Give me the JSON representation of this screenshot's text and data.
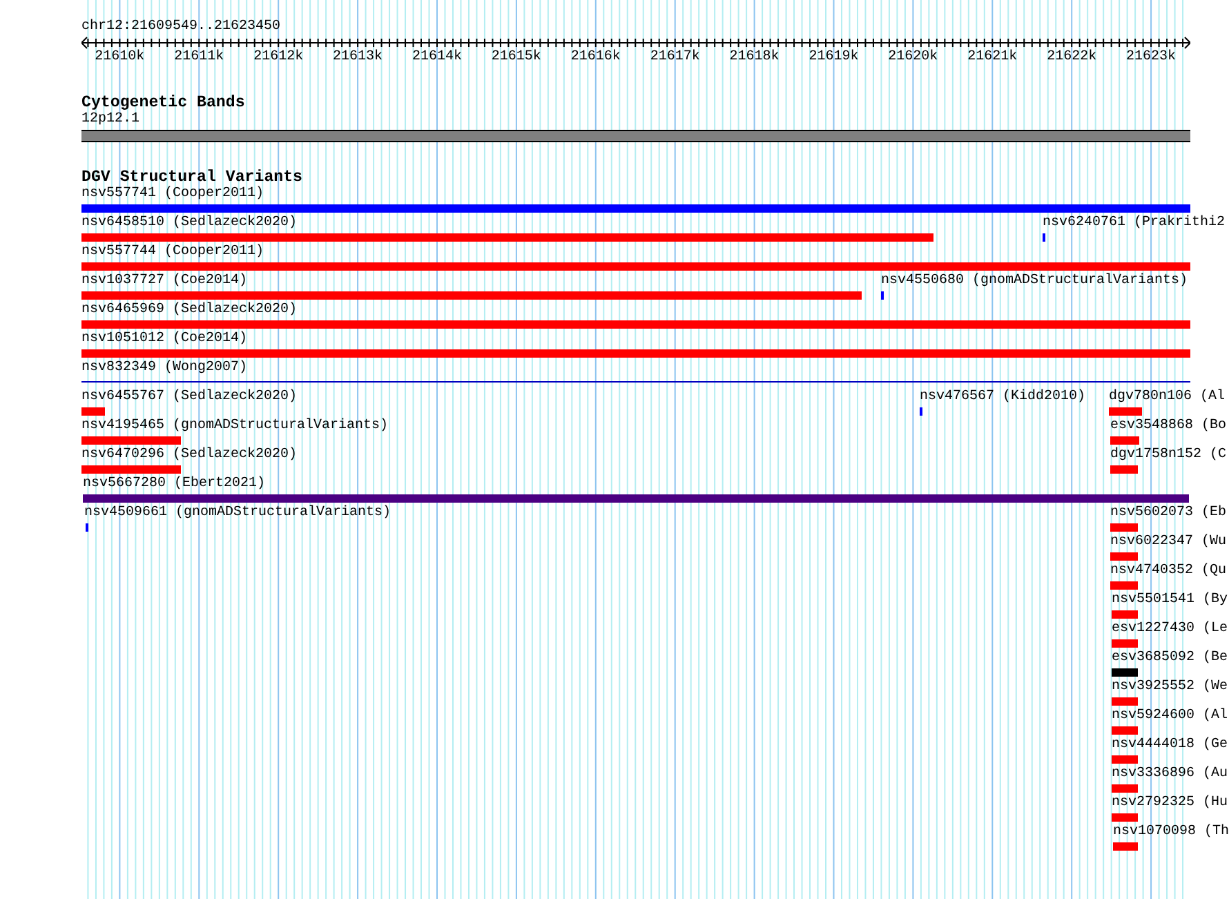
{
  "ruler": {
    "location": "chr12:21609549..21623450",
    "ticks": [
      "21610k",
      "21611k",
      "21612k",
      "21613k",
      "21614k",
      "21615k",
      "21616k",
      "21617k",
      "21618k",
      "21619k",
      "21620k",
      "21621k",
      "21622k",
      "21623k"
    ]
  },
  "tracks": [
    {
      "kind": "bands",
      "title": "Cytogenetic Bands",
      "features": [
        {
          "label": "12p12.1",
          "color": "#808080"
        }
      ]
    },
    {
      "kind": "variants",
      "title": "DGV Structural Variants",
      "features": [
        {
          "label": "nsv557741 (Cooper2011)",
          "color": "#0000ff"
        },
        {
          "label": "nsv6458510 (Sedlazeck2020)",
          "color": "#ff0000"
        },
        {
          "label": "nsv6240761 (Prakrithi2",
          "color": "#0000ff"
        },
        {
          "label": "nsv557744 (Cooper2011)",
          "color": "#ff0000"
        },
        {
          "label": "nsv1037727 (Coe2014)",
          "color": "#ff0000"
        },
        {
          "label": "nsv4550680 (gnomADStructuralVariants)",
          "color": "#0000ff"
        },
        {
          "label": "nsv6465969 (Sedlazeck2020)",
          "color": "#ff0000"
        },
        {
          "label": "nsv1051012 (Coe2014)",
          "color": "#ff0000"
        },
        {
          "label": "nsv832349 (Wong2007)",
          "color": "#0000c0"
        },
        {
          "label": "nsv6455767 (Sedlazeck2020)",
          "color": "#ff0000"
        },
        {
          "label": "nsv476567 (Kidd2010)",
          "color": "#0000ff"
        },
        {
          "label": "dgv780n106 (Al",
          "color": "#ff0000"
        },
        {
          "label": "nsv4195465 (gnomADStructuralVariants)",
          "color": "#ff0000"
        },
        {
          "label": "esv3548868 (Bo",
          "color": "#ff0000"
        },
        {
          "label": "nsv6470296 (Sedlazeck2020)",
          "color": "#ff0000"
        },
        {
          "label": "dgv1758n152 (C",
          "color": "#ff0000"
        },
        {
          "label": "nsv5667280 (Ebert2021)",
          "color": "#4b0082"
        },
        {
          "label": "nsv4509661 (gnomADStructuralVariants)",
          "color": "#0000ff"
        },
        {
          "label": "nsv5602073 (Eb",
          "color": "#ff0000"
        },
        {
          "label": "nsv6022347 (Wu",
          "color": "#ff0000"
        },
        {
          "label": "nsv4740352 (Qu",
          "color": "#ff0000"
        },
        {
          "label": "nsv5501541 (By",
          "color": "#ff0000"
        },
        {
          "label": "esv1227430 (Le",
          "color": "#ff0000"
        },
        {
          "label": "esv3685092 (Be",
          "color": "#000000"
        },
        {
          "label": "nsv3925552 (We",
          "color": "#ff0000"
        },
        {
          "label": "nsv5924600 (Al",
          "color": "#ff0000"
        },
        {
          "label": "nsv4444018 (Ge",
          "color": "#ff0000"
        },
        {
          "label": "nsv3336896 (Au",
          "color": "#ff0000"
        },
        {
          "label": "nsv2792325 (Hu",
          "color": "#ff0000"
        },
        {
          "label": "nsv1070098 (Th",
          "color": "#ff0000"
        }
      ]
    }
  ]
}
